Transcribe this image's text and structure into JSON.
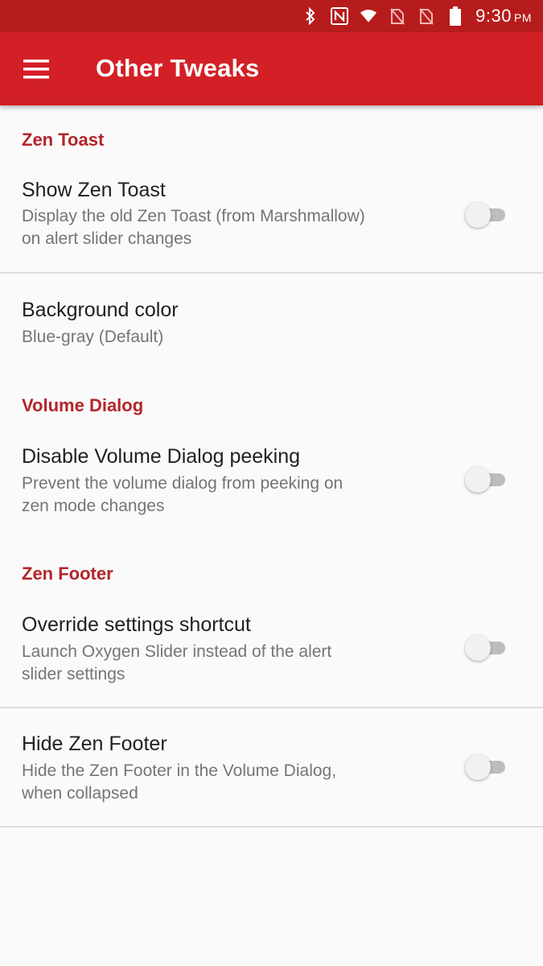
{
  "status_bar": {
    "time": "9:30",
    "ampm": "PM",
    "icons": [
      "bluetooth-icon",
      "nfc-icon",
      "wifi-icon",
      "no-sim-icon",
      "no-sim-icon",
      "battery-icon"
    ]
  },
  "toolbar": {
    "title": "Other Tweaks",
    "menu_icon": "hamburger-menu-icon",
    "color": "#d32027"
  },
  "sections": [
    {
      "header": "Zen Toast",
      "items": [
        {
          "title": "Show Zen Toast",
          "summary_line1": "Display the old Zen Toast (from Marshmallow)",
          "summary_line2": "on alert slider changes",
          "switch": false
        },
        {
          "title": "Background color",
          "summary_line1": "Blue-gray (Default)"
        }
      ]
    },
    {
      "header": "Volume Dialog",
      "items": [
        {
          "title": "Disable Volume Dialog peeking",
          "summary_line1": "Prevent the volume dialog from peeking on",
          "summary_line2": "zen mode changes",
          "switch": false
        }
      ]
    },
    {
      "header": "Zen Footer",
      "items": [
        {
          "title": "Override settings shortcut",
          "summary_line1": "Launch Oxygen Slider instead of the alert",
          "summary_line2": "slider settings",
          "switch": false
        },
        {
          "title": "Hide Zen Footer",
          "summary_line1": "Hide the Zen Footer in the Volume Dialog,",
          "summary_line2": "when collapsed",
          "switch": false
        }
      ]
    }
  ],
  "colors": {
    "accent": "#b3252b",
    "status_bar": "#b71c1c",
    "background": "#fafafa"
  }
}
